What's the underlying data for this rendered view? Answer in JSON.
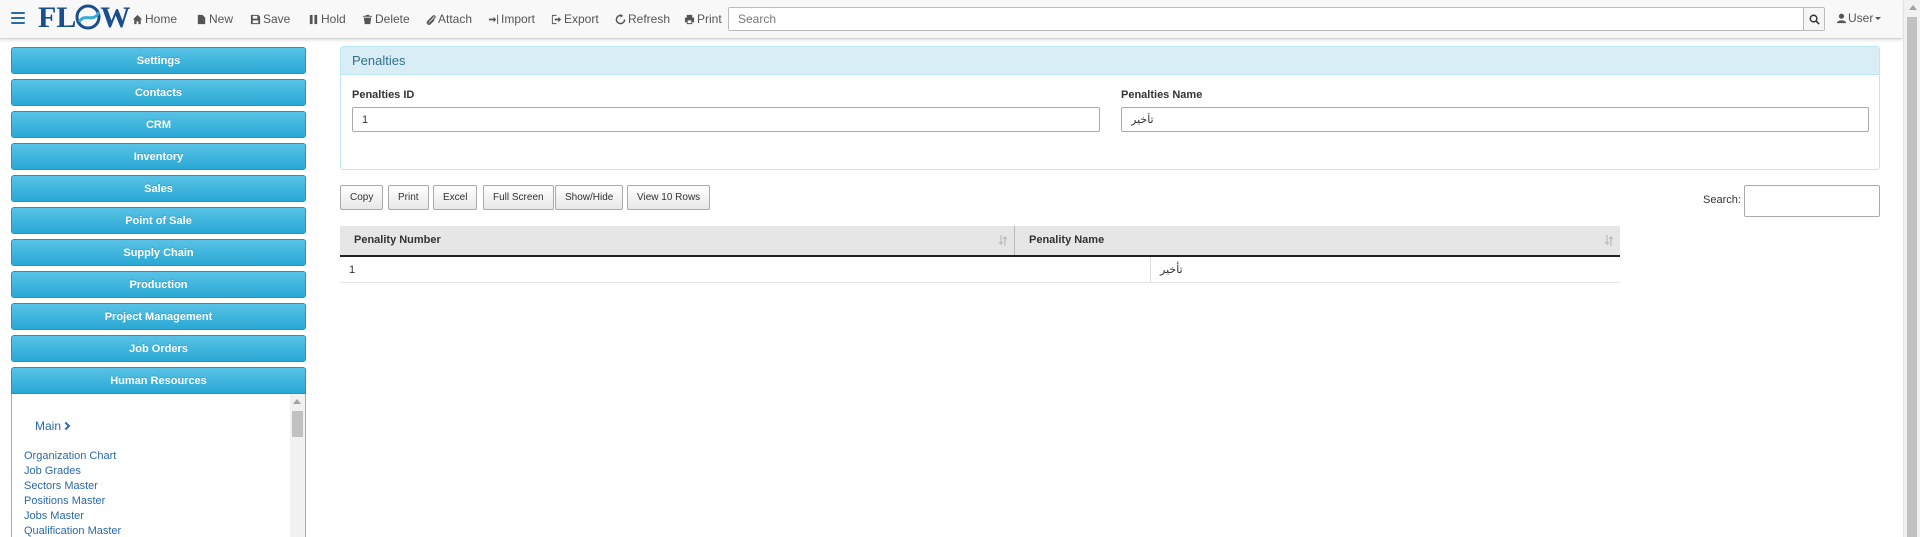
{
  "app": {
    "logo_text_left": "FL",
    "logo_text_right": "W"
  },
  "toolbar": {
    "home": "Home",
    "new": "New",
    "save": "Save",
    "hold": "Hold",
    "delete": "Delete",
    "attach": "Attach",
    "import": "Import",
    "export": "Export",
    "refresh": "Refresh",
    "print": "Print",
    "search_placeholder": "Search",
    "user": "User"
  },
  "sidebar": {
    "items": [
      {
        "label": "Settings"
      },
      {
        "label": "Contacts"
      },
      {
        "label": "CRM"
      },
      {
        "label": "Inventory"
      },
      {
        "label": "Sales"
      },
      {
        "label": "Point of Sale"
      },
      {
        "label": "Supply Chain"
      },
      {
        "label": "Production"
      },
      {
        "label": "Project Management"
      },
      {
        "label": "Job Orders"
      },
      {
        "label": "Human Resources"
      }
    ],
    "hr_main": "Main",
    "hr_links": [
      "Organization Chart",
      "Job Grades",
      "Sectors Master",
      "Positions Master",
      "Jobs Master",
      "Qualification Master"
    ]
  },
  "panel": {
    "title": "Penalties",
    "id_label": "Penalties ID",
    "id_value": "1",
    "name_label": "Penalties Name",
    "name_value": "تأخير"
  },
  "datatable": {
    "buttons": {
      "copy": "Copy",
      "print": "Print",
      "excel": "Excel",
      "fullscreen": "Full Screen",
      "showhide": "Show/Hide",
      "viewrows": "View 10 Rows"
    },
    "search_label": "Search:",
    "columns": [
      "Penality Number",
      "Penality Name"
    ],
    "rows": [
      {
        "number": "1",
        "name": "تأخير"
      }
    ]
  }
}
